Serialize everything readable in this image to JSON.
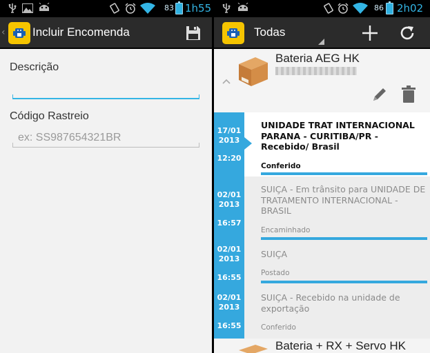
{
  "colors": {
    "accent": "#35a8de",
    "holo_blue": "#33b5e5",
    "logo_yellow": "#f5c400",
    "action_bar": "#2b2b2b"
  },
  "left": {
    "status": {
      "battery": "83",
      "time": "1h55"
    },
    "action_bar": {
      "title": "Incluir Encomenda",
      "save_icon": "save-icon"
    },
    "form": {
      "descricao_label": "Descrição",
      "descricao_value": "",
      "codigo_label": "Código Rastreio",
      "codigo_placeholder": "ex: SS987654321BR"
    }
  },
  "right": {
    "status": {
      "battery": "86",
      "time": "2h02"
    },
    "action_bar": {
      "title": "Todas",
      "add_icon": "plus-icon",
      "refresh_icon": "refresh-icon"
    },
    "package": {
      "name": "Bateria AEG HK",
      "events": [
        {
          "date": "17/01\n2013",
          "time": "12:20",
          "description": "UNIDADE TRAT INTERNACIONAL PARANA - CURITIBA/PR - Recebido/ Brasil",
          "status": "Conferido"
        },
        {
          "date": "02/01\n2013",
          "time": "16:57",
          "description": "SUIÇA - Em trânsito para UNIDADE DE TRATAMENTO INTERNACIONAL - BRASIL",
          "status": "Encaminhado"
        },
        {
          "date": "02/01\n2013",
          "time": "16:55",
          "description": "SUIÇA",
          "status": "Postado"
        },
        {
          "date": "02/01\n2013",
          "time": "16:55",
          "description": "SUIÇA - Recebido na unidade de exportação",
          "status": "Conferido"
        }
      ]
    },
    "package2": {
      "name": "Bateria + RX + Servo HK"
    }
  }
}
